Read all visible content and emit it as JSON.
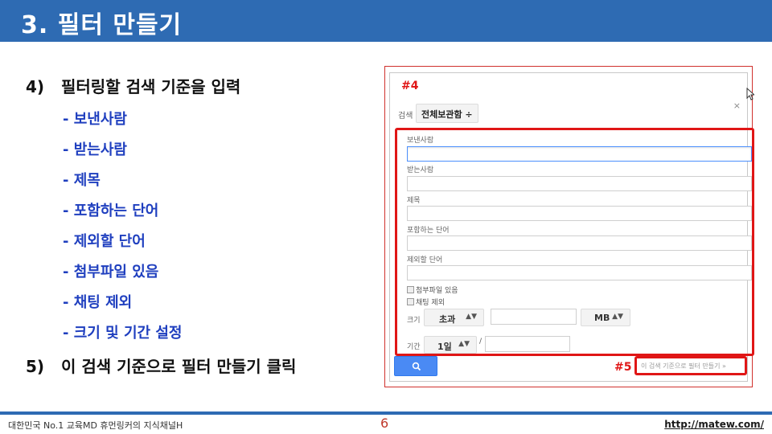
{
  "title": "3. 필터 만들기",
  "steps": [
    {
      "num": "4)",
      "text": "필터링할 검색 기준을 입력"
    },
    {
      "num": "5)",
      "text": "이 검색 기준으로 필터 만들기 클릭"
    }
  ],
  "bullets": [
    "- 보낸사람",
    "- 받는사람",
    "- 제목",
    "- 포함하는 단어",
    "- 제외할 단어",
    "- 첨부파일 있음",
    "- 채팅 제외",
    "- 크기 및 기간 설정"
  ],
  "panel": {
    "tag4": "#4",
    "tag5": "#5",
    "close": "×",
    "scope_label": "검색",
    "scope_value": "전체보관함 ÷",
    "fields": [
      "보낸사람",
      "받는사람",
      "제목",
      "포함하는 단어",
      "제외할 단어"
    ],
    "has_attachment": "첨부파일 있음",
    "exclude_chat": "채팅 제외",
    "size_label": "크기",
    "size_op": "초과",
    "size_unit": "MB",
    "date_label": "기간",
    "date_range": "1일",
    "date_sep": "/",
    "create_filter_link": "이 검색 기준으로 필터 만들기 »"
  },
  "footer": {
    "left": "대한민국 No.1 교육MD 휴먼링커의 지식채널H",
    "page": "6",
    "url": "http://matew.com/"
  }
}
